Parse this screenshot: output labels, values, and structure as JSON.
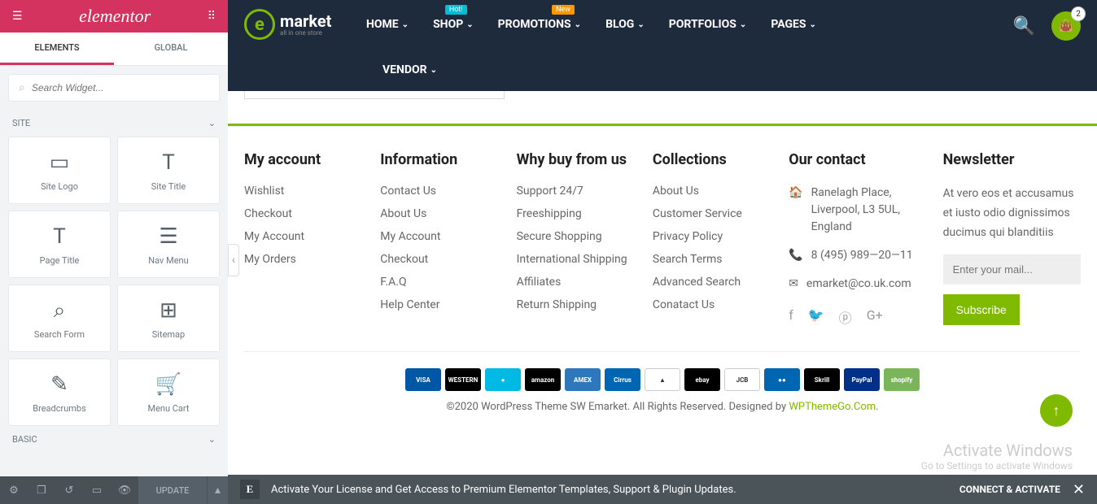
{
  "elementor": {
    "logo": "elementor",
    "tabs": {
      "elements": "ELEMENTS",
      "global": "GLOBAL"
    },
    "search_placeholder": "Search Widget...",
    "categories": {
      "site": "SITE",
      "basic": "BASIC"
    },
    "widgets": [
      {
        "title": "Site Logo",
        "icon": "▭"
      },
      {
        "title": "Site Title",
        "icon": "T"
      },
      {
        "title": "Page Title",
        "icon": "T"
      },
      {
        "title": "Nav Menu",
        "icon": "☰"
      },
      {
        "title": "Search Form",
        "icon": "⌕"
      },
      {
        "title": "Sitemap",
        "icon": "⊞"
      },
      {
        "title": "Breadcrumbs",
        "icon": "✎"
      },
      {
        "title": "Menu Cart",
        "icon": "🛒"
      }
    ],
    "update_label": "UPDATE"
  },
  "site": {
    "logo_mark": "e",
    "logo_text": "market",
    "logo_sub": "all in one store",
    "nav": [
      {
        "label": "HOME",
        "badge": null
      },
      {
        "label": "SHOP",
        "badge": "Hot!",
        "badge_class": "badge-hot"
      },
      {
        "label": "PROMOTIONS",
        "badge": "New",
        "badge_class": "badge-new"
      },
      {
        "label": "BLOG",
        "badge": null
      },
      {
        "label": "PORTFOLIOS",
        "badge": null
      },
      {
        "label": "PAGES",
        "badge": null
      }
    ],
    "nav_row2": {
      "label": "VENDOR"
    },
    "cart_count": "2"
  },
  "footer": {
    "cols": [
      {
        "heading": "My account",
        "links": [
          "Wishlist",
          "Checkout",
          "My Account",
          "My Orders"
        ]
      },
      {
        "heading": "Information",
        "links": [
          "Contact Us",
          "About Us",
          "My Account",
          "Checkout",
          "F.A.Q",
          "Help Center"
        ]
      },
      {
        "heading": "Why buy from us",
        "links": [
          "Support 24/7",
          "Freeshipping",
          "Secure Shopping",
          "International Shipping",
          "Affiliates",
          "Return Shipping"
        ]
      },
      {
        "heading": "Collections",
        "links": [
          "About Us",
          "Customer Service",
          "Privacy Policy",
          "Search Terms",
          "Advanced Search",
          "Conatact Us"
        ]
      }
    ],
    "contact": {
      "heading": "Our contact",
      "address": "Ranelagh Place, Liverpool, L3 5UL, England",
      "phone": "8 (495) 989—20—11",
      "email": "emarket@co.uk.com"
    },
    "newsletter": {
      "heading": "Newsletter",
      "text": "At vero eos et accusamus et iusto odio dignissimos ducimus qui blanditiis",
      "placeholder": "Enter your mail...",
      "button": "Subscribe"
    },
    "payments": [
      {
        "label": "VISA",
        "bg": "#0057a3"
      },
      {
        "label": "WESTERN",
        "bg": "#000"
      },
      {
        "label": "●",
        "bg": "#00b9e4"
      },
      {
        "label": "amazon",
        "bg": "#000"
      },
      {
        "label": "AMEX",
        "bg": "#2e77bb"
      },
      {
        "label": "Cirrus",
        "bg": "#0066b2"
      },
      {
        "label": "▲",
        "bg": "#fff"
      },
      {
        "label": "ebay",
        "bg": "#000"
      },
      {
        "label": "JCB",
        "bg": "#fff"
      },
      {
        "label": "●●",
        "bg": "#0066b2"
      },
      {
        "label": "Skrill",
        "bg": "#000"
      },
      {
        "label": "PayPal",
        "bg": "#003087"
      },
      {
        "label": "shopify",
        "bg": "#7ab55c"
      }
    ],
    "copyright_prefix": "©2020 WordPress Theme SW Emarket. All Rights Reserved. Designed by ",
    "copyright_link": "WPThemeGo.Com",
    "copyright_suffix": "."
  },
  "watermark": {
    "title": "Activate Windows",
    "sub": "Go to Settings to activate Windows"
  },
  "notice": {
    "text": "Activate Your License and Get Access to Premium Elementor Templates, Support & Plugin Updates.",
    "action": "CONNECT & ACTIVATE"
  }
}
